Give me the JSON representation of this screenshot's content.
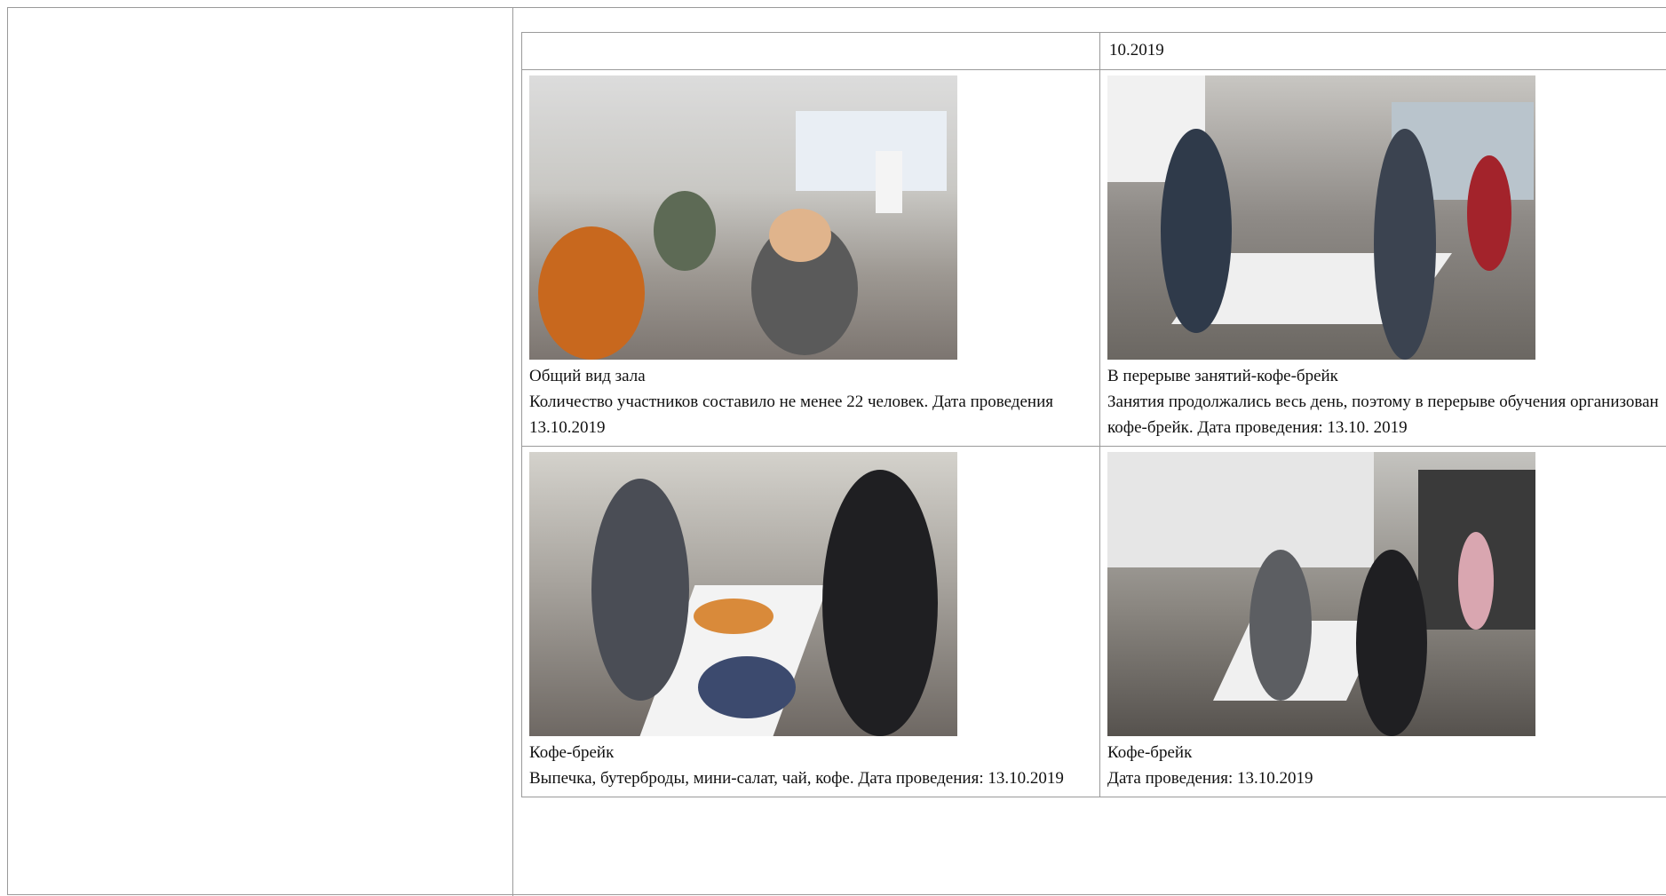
{
  "header_cell_right": "10.2019",
  "photos": [
    {
      "title": "Общий вид зала",
      "text": "Количество участников составило не менее 22 человек. Дата проведения 13.10.2019"
    },
    {
      "title": "В перерыве занятий-кофе-брейк",
      "text": "Занятия продолжались весь день, поэтому в перерыве обучения организован кофе-брейк. Дата проведения: 13.10. 2019"
    },
    {
      "title": "Кофе-брейк",
      "text": "Выпечка, бутерброды, мини-салат, чай, кофе. Дата проведения: 13.10.2019"
    },
    {
      "title": "Кофе-брейк",
      "text": "Дата проведения: 13.10.2019"
    }
  ]
}
